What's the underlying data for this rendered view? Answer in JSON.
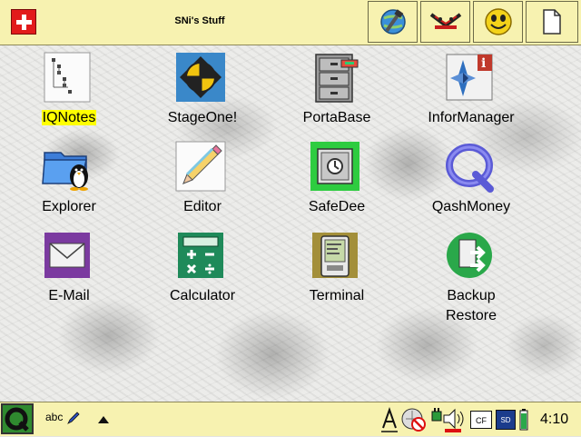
{
  "window": {
    "title": "SNi's Stuff"
  },
  "toolbar": {
    "buttons": [
      {
        "name": "network-tool-icon"
      },
      {
        "name": "sign-icon"
      },
      {
        "name": "smiley-icon"
      },
      {
        "name": "document-icon"
      }
    ]
  },
  "desktop": {
    "icons": [
      {
        "label": "IQNotes",
        "icon": "notes-tree-icon",
        "selected": true
      },
      {
        "label": "StageOne!",
        "icon": "stageone-icon"
      },
      {
        "label": "PortaBase",
        "icon": "file-cabinet-icon"
      },
      {
        "label": "InforManager",
        "icon": "infomanager-icon"
      },
      {
        "label": "Explorer",
        "icon": "folder-penguin-icon"
      },
      {
        "label": "Editor",
        "icon": "pencil-icon"
      },
      {
        "label": "SafeDee",
        "icon": "safe-icon"
      },
      {
        "label": "QashMoney",
        "icon": "qashmoney-icon"
      },
      {
        "label": "E-Mail",
        "icon": "envelope-icon"
      },
      {
        "label": "Calculator",
        "icon": "calculator-icon"
      },
      {
        "label": "Terminal",
        "icon": "terminal-icon"
      },
      {
        "label": "Backup\nRestore",
        "icon": "backup-restore-icon"
      }
    ]
  },
  "taskbar": {
    "input_method": "abc",
    "clock": "4:10",
    "cf_label": "CF",
    "sd_label": "SD"
  },
  "colors": {
    "topbar_bg": "#f7f2b0",
    "selection_highlight": "#ffff00",
    "swiss_red": "#e21b1b"
  }
}
